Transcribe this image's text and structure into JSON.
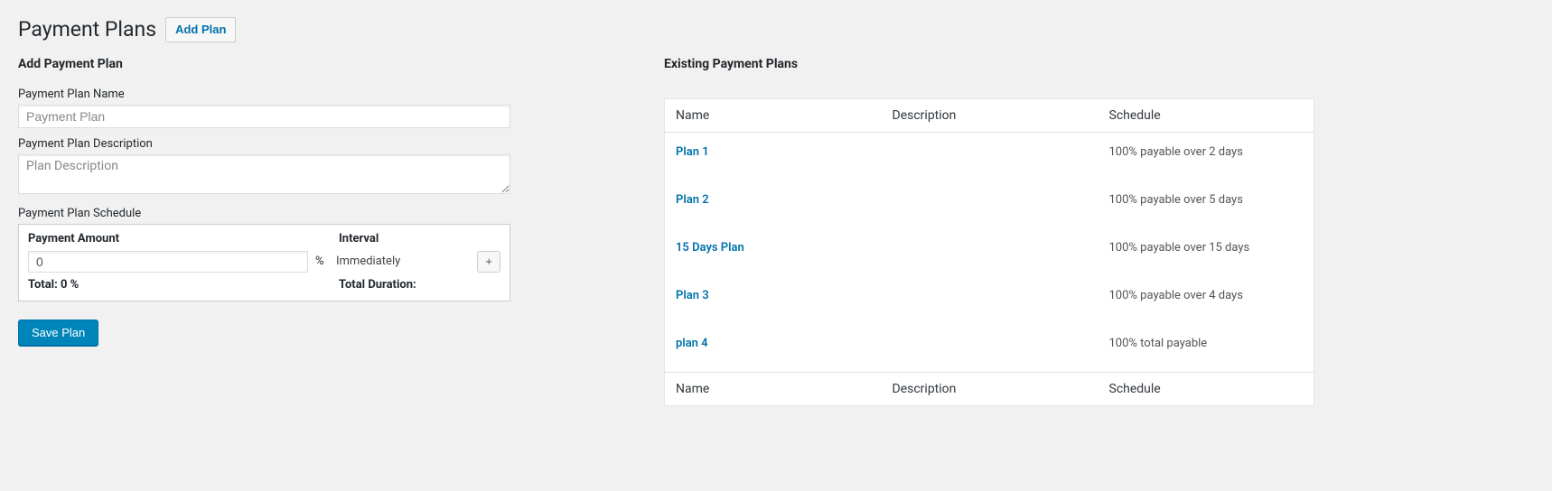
{
  "header": {
    "title": "Payment Plans",
    "add_button": "Add Plan"
  },
  "form": {
    "heading": "Add Payment Plan",
    "name_label": "Payment Plan Name",
    "name_placeholder": "Payment Plan",
    "desc_label": "Payment Plan Description",
    "desc_placeholder": "Plan Description",
    "schedule_label": "Payment Plan Schedule",
    "schedule": {
      "amount_header": "Payment Amount",
      "interval_header": "Interval",
      "amount_value": "0",
      "percent": "%",
      "interval_text": "Immediately",
      "plus_label": "+",
      "total_label": "Total: 0 %",
      "duration_label": "Total Duration:"
    },
    "save_button": "Save Plan"
  },
  "existing": {
    "heading": "Existing Payment Plans",
    "columns": {
      "name": "Name",
      "description": "Description",
      "schedule": "Schedule"
    },
    "rows": [
      {
        "name": "Plan 1",
        "description": "",
        "schedule": "100% payable over 2 days"
      },
      {
        "name": "Plan 2",
        "description": "",
        "schedule": "100% payable over 5 days"
      },
      {
        "name": "15 Days Plan",
        "description": "",
        "schedule": "100% payable over 15 days"
      },
      {
        "name": "Plan 3",
        "description": "",
        "schedule": "100% payable over 4 days"
      },
      {
        "name": "plan 4",
        "description": "",
        "schedule": "100% total payable"
      }
    ]
  }
}
